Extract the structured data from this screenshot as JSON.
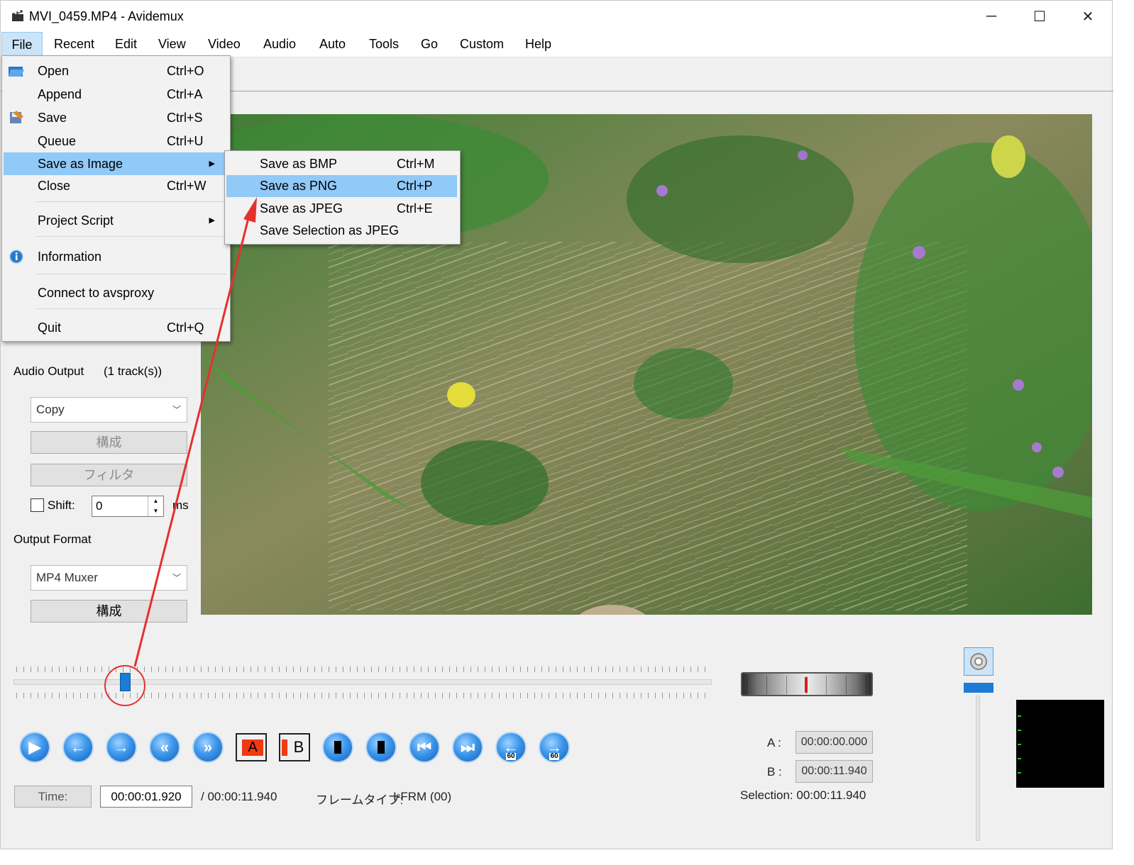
{
  "window": {
    "title": "MVI_0459.MP4 - Avidemux",
    "minimize_glyph": "─",
    "maximize_glyph": "☐",
    "close_glyph": "✕"
  },
  "menubar": {
    "items": [
      "File",
      "Recent",
      "Edit",
      "View",
      "Video",
      "Audio",
      "Auto",
      "Tools",
      "Go",
      "Custom",
      "Help"
    ]
  },
  "file_menu": {
    "items": [
      {
        "label": "Open",
        "shortcut": "Ctrl+O",
        "icon": "open-folder-icon"
      },
      {
        "label": "Append",
        "shortcut": "Ctrl+A"
      },
      {
        "label": "Save",
        "shortcut": "Ctrl+S",
        "icon": "save-icon"
      },
      {
        "label": "Queue",
        "shortcut": "Ctrl+U"
      },
      {
        "label": "Save as Image",
        "shortcut": "",
        "submenu_glyph": "▶"
      },
      {
        "label": "Close",
        "shortcut": "Ctrl+W"
      },
      {
        "label": "Project Script",
        "shortcut": "",
        "submenu_glyph": "▶"
      },
      {
        "label": "Information",
        "shortcut": "",
        "icon": "info-icon"
      },
      {
        "label": "Connect to avsproxy",
        "shortcut": ""
      },
      {
        "label": "Quit",
        "shortcut": "Ctrl+Q"
      }
    ],
    "open_item": "Save as Image"
  },
  "image_submenu": {
    "items": [
      {
        "label": "Save as BMP",
        "shortcut": "Ctrl+M"
      },
      {
        "label": "Save as PNG",
        "shortcut": "Ctrl+P"
      },
      {
        "label": "Save as JPEG",
        "shortcut": "Ctrl+E"
      },
      {
        "label": "Save Selection as JPEG",
        "shortcut": ""
      }
    ],
    "highlighted": "Save as PNG"
  },
  "left_panel": {
    "audio_output_label": "Audio Output",
    "audio_tracks": "(1 track(s))",
    "audio_codec": "Copy",
    "configure_label": "構成",
    "filter_label": "フィルタ",
    "shift_label": "Shift:",
    "shift_value": "0",
    "shift_unit": "ms",
    "output_format_label": "Output Format",
    "output_format": "MP4 Muxer",
    "format_configure_label": "構成"
  },
  "playback": {
    "time_button": "Time:",
    "current_time": "00:00:01.920",
    "total_time": "/ 00:00:11.940",
    "frame_type_label": "フレームタイプ:",
    "frame_type": "I-FRM (00)",
    "marker_a_label": "A :",
    "marker_a": "00:00:00.000",
    "marker_b_label": "B :",
    "marker_b": "00:00:11.940",
    "selection": "Selection: 00:00:11.940",
    "position_fraction": 0.16,
    "marker_a_glyph": "A",
    "marker_b_glyph": "B",
    "seek_label": "60"
  },
  "colors": {
    "accent": "#1c7cd6",
    "menu_highlight": "#91c9f7",
    "annotation": "#e53030"
  }
}
